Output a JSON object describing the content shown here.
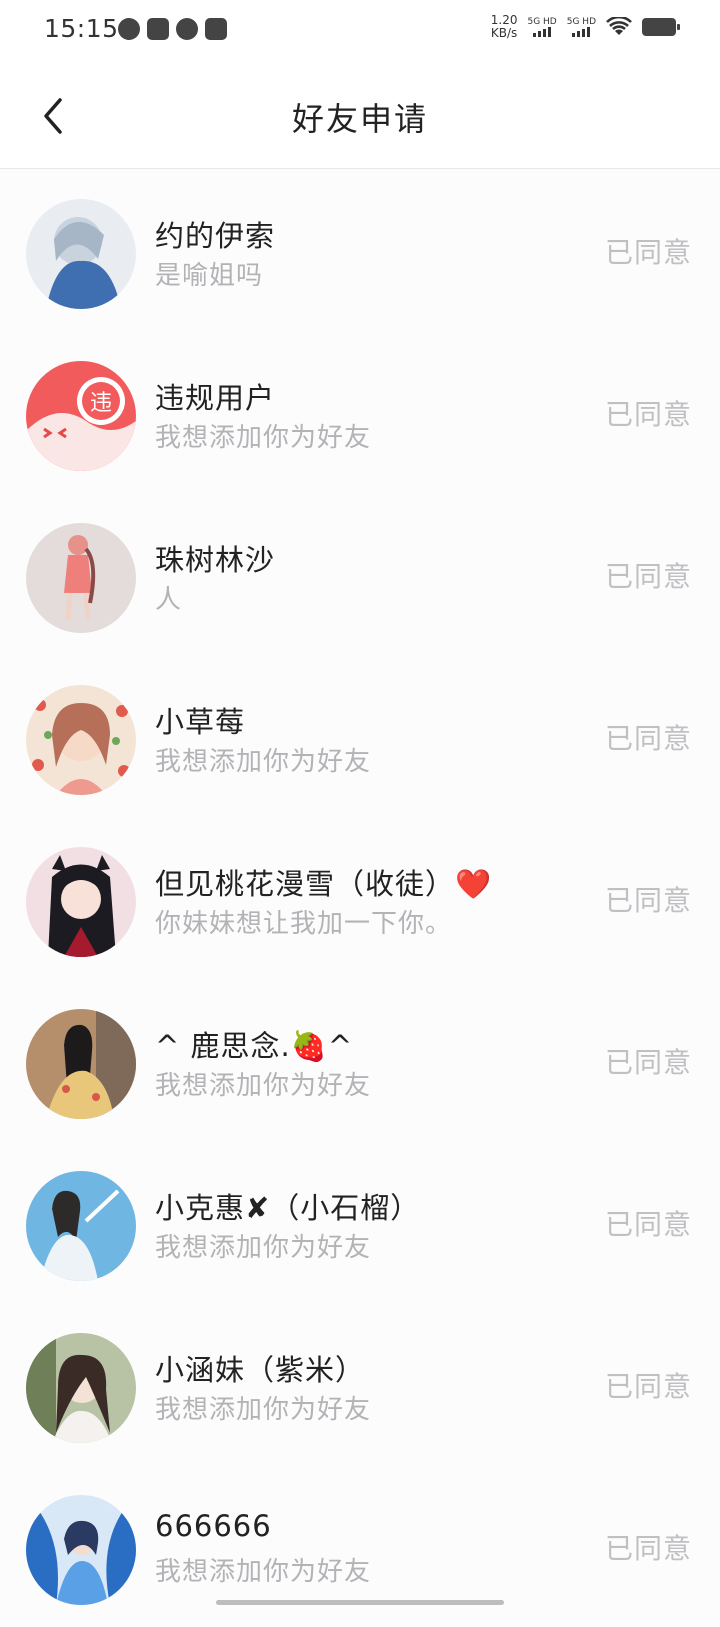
{
  "status_bar": {
    "time": "15:15",
    "net_speed_value": "1.20",
    "net_speed_unit": "KB/s",
    "sim1": "5G HD",
    "sim2": "5G HD"
  },
  "header": {
    "title": "好友申请"
  },
  "requests": [
    {
      "name": "约的伊索",
      "message": "是喻姐吗",
      "status": "已同意",
      "avatar_color": "#9bb0c8"
    },
    {
      "name": "违规用户",
      "message": "我想添加你为好友",
      "status": "已同意",
      "avatar_color": "#f25b5b"
    },
    {
      "name": "珠树林沙",
      "message": "人",
      "status": "已同意",
      "avatar_color": "#e3dcda"
    },
    {
      "name": "小草莓",
      "message": "我想添加你为好友",
      "status": "已同意",
      "avatar_color": "#e7b9a4"
    },
    {
      "name": "但见桃花漫雪（收徒）❤️",
      "message": "你妹妹想让我加一下你。",
      "status": "已同意",
      "avatar_color": "#2c2a33"
    },
    {
      "name": "^ 鹿思念.🍓^",
      "message": "我想添加你为好友",
      "status": "已同意",
      "avatar_color": "#8a6a4f"
    },
    {
      "name": "小克惠✘（小石榴）",
      "message": "我想添加你为好友",
      "status": "已同意",
      "avatar_color": "#5fa8d8"
    },
    {
      "name": "小涵妹（紫米）",
      "message": "我想添加你为好友",
      "status": "已同意",
      "avatar_color": "#7f8f6a"
    },
    {
      "name": "666666",
      "message": "我想添加你为好友",
      "status": "已同意",
      "avatar_color": "#2a6ec4"
    }
  ],
  "violation_badge": "违"
}
